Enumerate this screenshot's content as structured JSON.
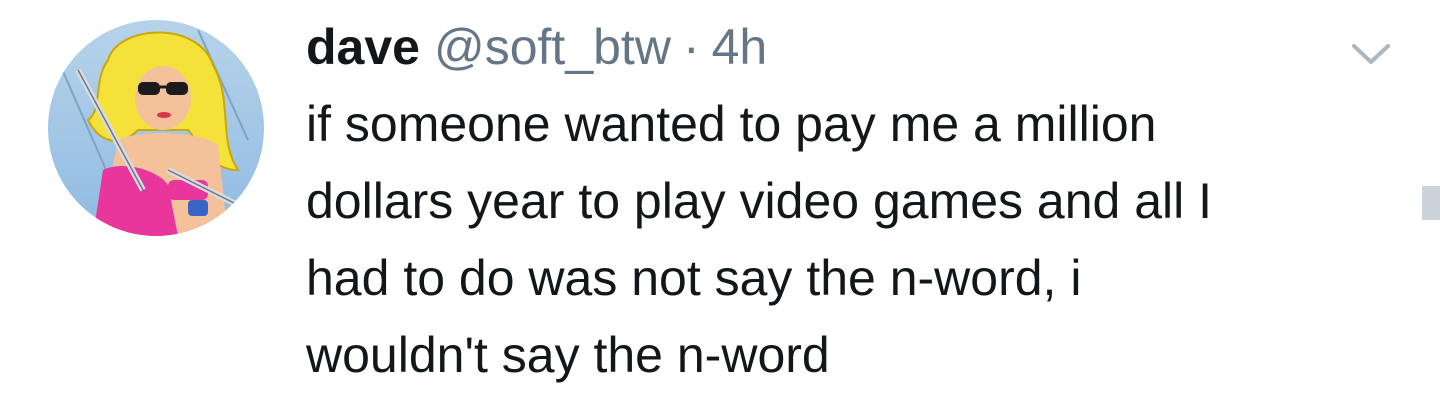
{
  "tweet": {
    "author": {
      "display_name": "dave",
      "handle": "@soft_btw",
      "avatar_icon": "illustrated-avatar-blonde-woman-sunglasses"
    },
    "separator": "·",
    "timestamp": "4h",
    "text": "if someone wanted to pay me a million\ndollars year to play video games and all I\nhad to do was not say the n-word, i\nwouldn't say the n-word",
    "menu_icon": "chevron-down-icon"
  },
  "colors": {
    "name": "#14171a",
    "secondary": "#657786",
    "text": "#14171a",
    "chevron": "#aab8c2",
    "background": "#ffffff"
  }
}
